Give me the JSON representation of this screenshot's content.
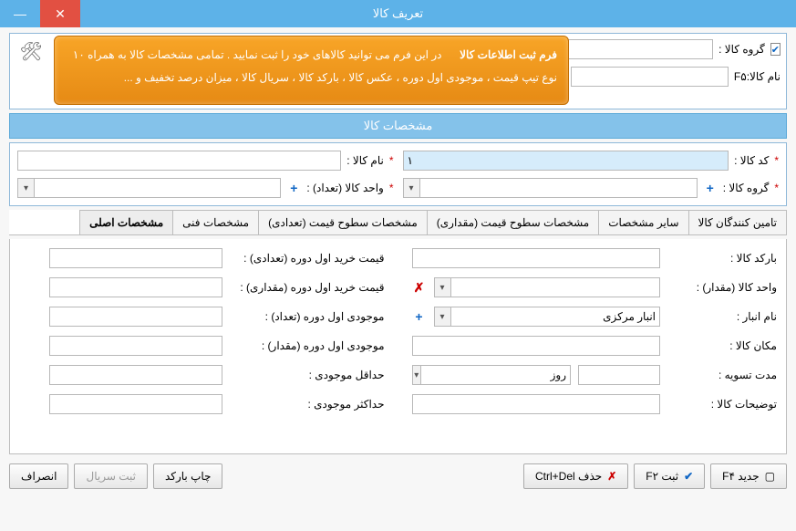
{
  "window": {
    "title": "تعریف کالا"
  },
  "top": {
    "group_label": "گروه کالا :",
    "name_label": "نام کالا:F۵",
    "name_value": "",
    "help_title": "فرم ثبت اطلاعات کالا",
    "help_body": "در این فرم می توانید کالاهای خود را ثبت نمایید . تمامی مشخصات کالا به همراه ۱۰ نوع تیپ قیمت ، موجودی اول دوره ، عکس کالا ، بارکد کالا ، سریال کالا ، میزان درصد تخفیف و ..."
  },
  "section": {
    "title": "مشخصات کالا"
  },
  "props": {
    "code_label": "کد کالا :",
    "code_value": "۱",
    "name_label": "نام کالا :",
    "name_value": "",
    "group_label": "گروه کالا :",
    "unit_label": "واحد کالا (تعداد) :"
  },
  "tabs": [
    "تامین کنندگان کالا",
    "سایر مشخصات",
    "مشخصات سطوح قیمت (مقداری)",
    "مشخصات سطوح قیمت (تعدادی)",
    "مشخصات فنی",
    "مشخصات اصلی"
  ],
  "right": {
    "barcode_label": "بارکد کالا :",
    "unit_qty_label": "واحد کالا (مقدار) :",
    "warehouse_label": "نام انبار :",
    "warehouse_value": "انبار مرکزی",
    "location_label": "مکان کالا :",
    "settle_label": "مدت تسویه :",
    "settle_unit": "روز",
    "desc_label": "توضیحات کالا :"
  },
  "left": {
    "buy1_label": "قیمت خرید اول دوره (تعدادی) :",
    "buy2_label": "قیمت خرید اول دوره (مقداری) :",
    "inv1_label": "موجودی اول دوره (تعداد) :",
    "inv2_label": "موجودی اول دوره (مقدار) :",
    "min_label": "حداقل موجودی :",
    "max_label": "حداکثر موجودی :"
  },
  "footer": {
    "new": "جدید F۴",
    "save": "ثبت F۲",
    "delete": "حذف Ctrl+Del",
    "print_barcode": "چاپ بارکد",
    "serial": "ثبت سریال",
    "cancel": "انصراف"
  }
}
